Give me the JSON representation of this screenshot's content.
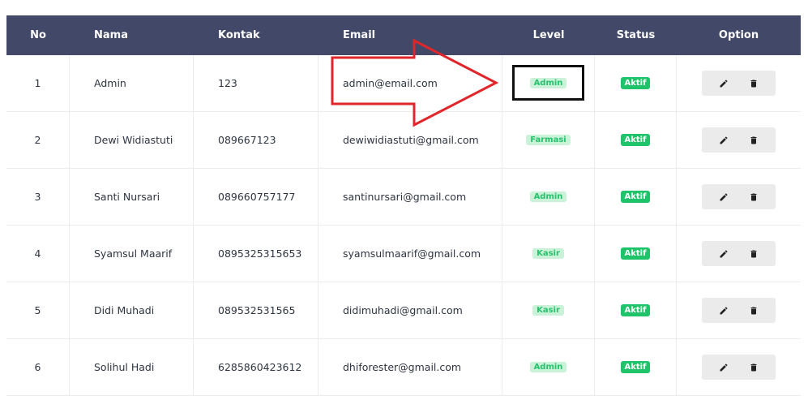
{
  "table": {
    "headers": {
      "no": "No",
      "nama": "Nama",
      "kontak": "Kontak",
      "email": "Email",
      "level": "Level",
      "status": "Status",
      "option": "Option"
    },
    "rows": [
      {
        "no": "1",
        "nama": "Admin",
        "kontak": "123",
        "email": "admin@email.com",
        "level": "Admin",
        "status": "Aktif"
      },
      {
        "no": "2",
        "nama": "Dewi Widiastuti",
        "kontak": "089667123",
        "email": "dewiwidiastuti@gmail.com",
        "level": "Farmasi",
        "status": "Aktif"
      },
      {
        "no": "3",
        "nama": "Santi Nursari",
        "kontak": "089660757177",
        "email": "santinursari@gmail.com",
        "level": "Admin",
        "status": "Aktif"
      },
      {
        "no": "4",
        "nama": "Syamsul Maarif",
        "kontak": "0895325315653",
        "email": "syamsulmaarif@gmail.com",
        "level": "Kasir",
        "status": "Aktif"
      },
      {
        "no": "5",
        "nama": "Didi Muhadi",
        "kontak": "089532531565",
        "email": "didimuhadi@gmail.com",
        "level": "Kasir",
        "status": "Aktif"
      },
      {
        "no": "6",
        "nama": "Solihul Hadi",
        "kontak": "6285860423612",
        "email": "dhiforester@gmail.com",
        "level": "Admin",
        "status": "Aktif"
      }
    ],
    "option_icons": [
      "pencil-icon",
      "trash-icon"
    ]
  },
  "colors": {
    "header_bg": "#414868",
    "level_badge_bg": "#c9f2d8",
    "level_badge_text": "#27c26c",
    "status_badge_bg": "#1fc36a",
    "annotation_arrow": "#e0262b",
    "annotation_box": "#111111"
  }
}
